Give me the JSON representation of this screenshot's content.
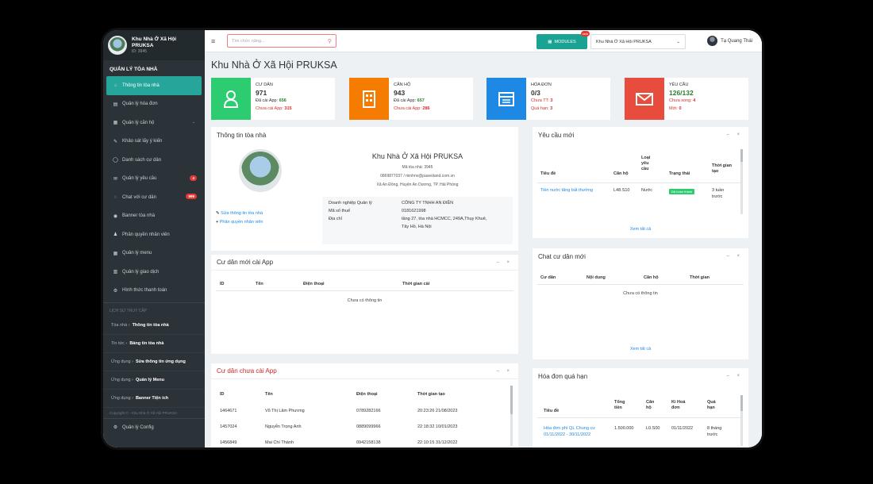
{
  "brand": {
    "name_line1": "Khu Nhà Ở Xã Hội",
    "name_line2": "PRUKSA",
    "id": "ID: 3945"
  },
  "sidebar": {
    "section_title": "QUẢN LÝ TÒA NHÀ",
    "items": [
      {
        "label": "Thông tin tòa nhà",
        "icon": "home-icon"
      },
      {
        "label": "Quản lý hóa đơn",
        "icon": "invoice-icon"
      },
      {
        "label": "Quản lý căn hộ",
        "icon": "apartment-icon"
      },
      {
        "label": "Khảo sát lấy ý kiến",
        "icon": "survey-icon"
      },
      {
        "label": "Danh sách cư dân",
        "icon": "user-icon"
      },
      {
        "label": "Quản lý yêu cầu",
        "icon": "request-icon",
        "badge": "4"
      },
      {
        "label": "Chat với cư dân",
        "icon": "chat-icon",
        "badge": "999"
      },
      {
        "label": "Banner tòa nhà",
        "icon": "banner-icon"
      },
      {
        "label": "Phân quyền nhân viên",
        "icon": "permission-icon"
      },
      {
        "label": "Quản lý menu",
        "icon": "menu-grid-icon"
      },
      {
        "label": "Quản lý giao dịch",
        "icon": "transaction-icon"
      },
      {
        "label": "Hình thức thanh toán",
        "icon": "payment-icon"
      }
    ],
    "recent_label": "LỊCH SỬ TRUY CẬP",
    "recent": [
      {
        "prefix": "Tòa nhà",
        "page": "Thông tin tòa nhà"
      },
      {
        "prefix": "Tin tức",
        "page": "Bảng tin tòa nhà"
      },
      {
        "prefix": "Ứng dụng",
        "page": "Sửa thông tin ứng dụng"
      },
      {
        "prefix": "Ứng dụng",
        "page": "Quản lý Menu"
      },
      {
        "prefix": "Ứng dụng",
        "page": "Banner Tiện ích"
      }
    ],
    "footer": "Copyright © - Khu Nhà Ở Xã Hội PRUKSA",
    "config": "Quản lý Config"
  },
  "topbar": {
    "search_placeholder": "Tìm chức năng...",
    "modules": "MODULES",
    "modules_badge": "new",
    "building_select": "Khu Nhà Ở Xã Hội PRUKSA",
    "user": "Tạ Quang Thái"
  },
  "page_title": "Khu Nhà Ở Xã Hội PRUKSA",
  "stats": [
    {
      "title": "CƯ DÂN",
      "value": "971",
      "line1_label": "Đã cài App:",
      "line1_value": "656",
      "line2_label": "Chưa cài App:",
      "line2_value": "315",
      "color": "#2ecc71"
    },
    {
      "title": "CĂN HỘ",
      "value": "943",
      "line1_label": "Đã cài App:",
      "line1_value": "657",
      "line2_label": "Chưa cài App:",
      "line2_value": "286",
      "color": "#f57c00"
    },
    {
      "title": "HÓA ĐƠN",
      "value": "0/3",
      "line1_label": "Chưa TT:",
      "line1_value": "3",
      "line2_label": "Quá hạn:",
      "line2_value": "3",
      "color": "#1e88e5"
    },
    {
      "title": "YÊU CẦU",
      "value": "126/132",
      "line1_label": "Chưa xong:",
      "line1_value": "4",
      "line2_label": "Mới:",
      "line2_value": "0",
      "color": "#e74c3c"
    }
  ],
  "building_info": {
    "header": "Thông tin tòa nhà",
    "name": "Khu Nhà Ở Xã Hội PRUKSA",
    "id_line": "Mã tòa nhà: 3945",
    "contact": "0869877037 / minhnv@paseoland.com.vn",
    "address": "Xã An Đồng, Huyện An Dương, TP. Hải Phòng",
    "edit_link": "Sửa thông tin tòa nhà",
    "perm_link": "Phân quyền nhân viên",
    "company_label": "Doanh nghiệp Quản lý",
    "company": "CÔNG TY TNHH AN ĐIỀN",
    "tax_label": "Mã số thuế",
    "tax": "0181621998",
    "addr_label": "Địa chỉ",
    "company_addr1": "tầng 27, tòa nhà HCMCC, 249A,Thụy Khuê,",
    "company_addr2": "Tây Hồ, Hà Nội"
  },
  "new_residents": {
    "header": "Cư dân mới cài App",
    "cols": [
      "ID",
      "Tên",
      "Điện thoại",
      "Thời gian cài"
    ],
    "empty": "Chưa có thông tin"
  },
  "no_app": {
    "header": "Cư dân chưa cài App",
    "cols": [
      "ID",
      "Tên",
      "Điện thoại",
      "Thời gian tạo"
    ],
    "rows": [
      [
        "1464671",
        "Vũ Thị Lâm Phương",
        "0789282166",
        "20:23:26 21/08/2023"
      ],
      [
        "1457024",
        "Nguyễn Trọng Anh",
        "0889099966",
        "22:18:32 10/01/2023"
      ],
      [
        "1456849",
        "Mai Chí Thành",
        "0942158138",
        "22:10:15 31/12/2022"
      ]
    ]
  },
  "requests": {
    "header": "Yêu cầu mới",
    "cols": [
      "Tiêu đề",
      "Căn hộ",
      "Loại yêu cầu",
      "Trạng thái",
      "Thời gian tạo"
    ],
    "row": {
      "title": "Tiền nước tăng bất thường",
      "apt": "L48.S10",
      "type": "Nước",
      "status": "Đã hoàn thành",
      "time": "3 tuần trước"
    },
    "see_all": "Xem tất cả"
  },
  "chat": {
    "header": "Chat cư dân mới",
    "cols": [
      "Cư dân",
      "Nội dung",
      "Căn hộ",
      "Thời gian"
    ],
    "empty": "Chưa có thông tin",
    "see_all": "Xem tất cả"
  },
  "overdue": {
    "header": "Hóa đơn quá hạn",
    "cols": [
      "Tiêu đề",
      "Tổng tiền",
      "Căn hộ",
      "Kì Hoá đơn",
      "Quá hạn"
    ],
    "row": {
      "title": "Hóa đơn phí QL Chung cư 01/11/2022 - 30/11/2022",
      "total": "1.500.000",
      "apt": "L0.S00",
      "period": "01/11/2022",
      "overdue": "8 tháng trước"
    }
  }
}
